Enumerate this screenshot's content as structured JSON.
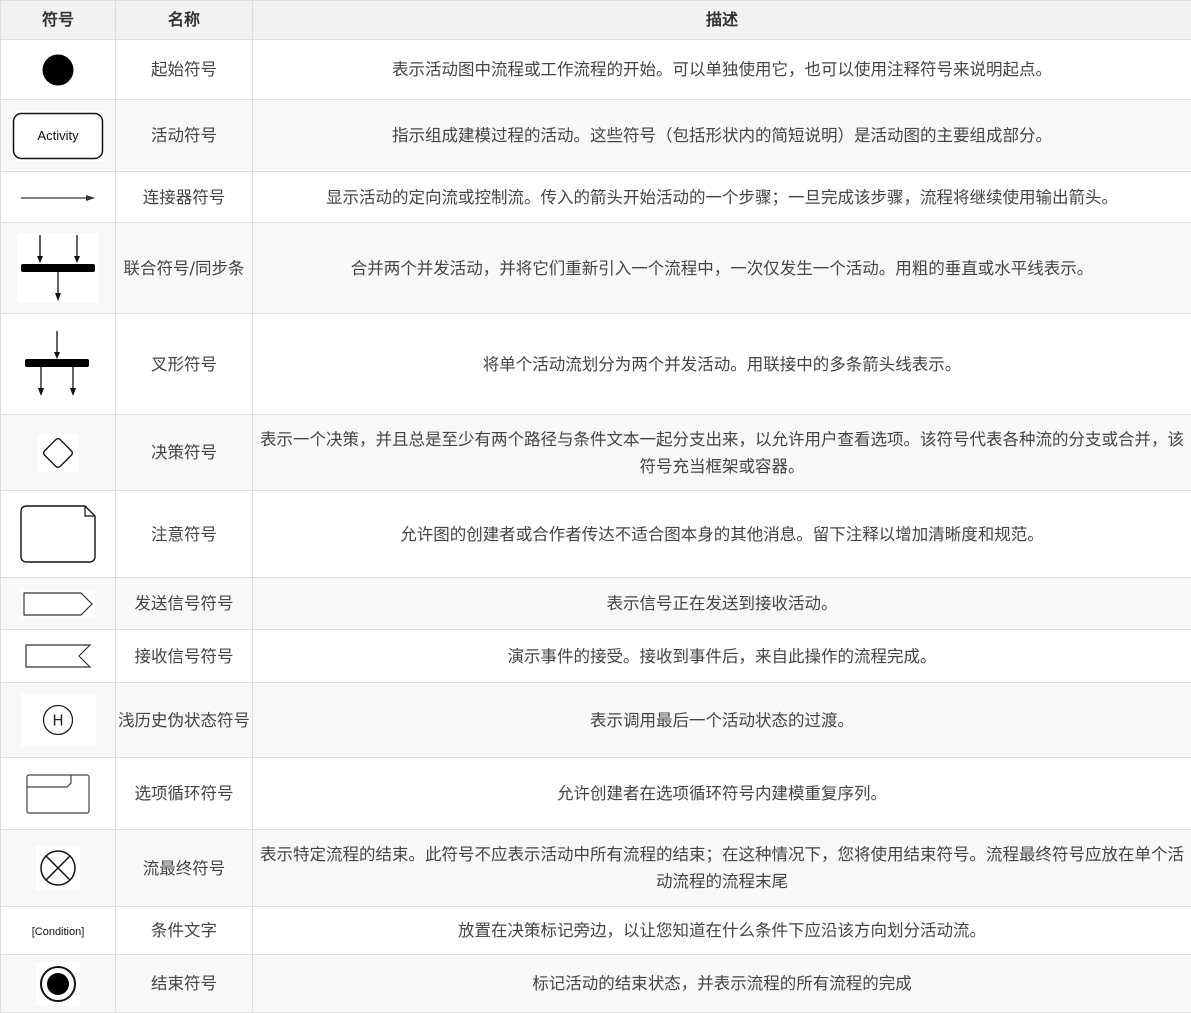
{
  "table": {
    "headers": {
      "symbol": "符号",
      "name": "名称",
      "description": "描述"
    },
    "rows": [
      {
        "icon": "initial-node-icon",
        "name": "起始符号",
        "description": "表示活动图中流程或工作流程的开始。可以单独使用它，也可以使用注释符号来说明起点。"
      },
      {
        "icon": "activity-icon",
        "icon_label": "Activity",
        "name": "活动符号",
        "description": "指示组成建模过程的活动。这些符号（包括形状内的简短说明）是活动图的主要组成部分。"
      },
      {
        "icon": "connector-arrow-icon",
        "name": "连接器符号",
        "description": "显示活动的定向流或控制流。传入的箭头开始活动的一个步骤；一旦完成该步骤，流程将继续使用输出箭头。"
      },
      {
        "icon": "join-bar-icon",
        "name": "联合符号/同步条",
        "description": "合并两个并发活动，并将它们重新引入一个流程中，一次仅发生一个活动。用粗的垂直或水平线表示。"
      },
      {
        "icon": "fork-bar-icon",
        "name": "叉形符号",
        "description": "将单个活动流划分为两个并发活动。用联接中的多条箭头线表示。"
      },
      {
        "icon": "decision-diamond-icon",
        "name": "决策符号",
        "description": "表示一个决策，并且总是至少有两个路径与条件文本一起分支出来，以允许用户查看选项。该符号代表各种流的分支或合并，该符号充当框架或容器。"
      },
      {
        "icon": "note-icon",
        "name": "注意符号",
        "description": "允许图的创建者或合作者传达不适合图本身的其他消息。留下注释以增加清晰度和规范。"
      },
      {
        "icon": "send-signal-icon",
        "name": "发送信号符号",
        "description": "表示信号正在发送到接收活动。"
      },
      {
        "icon": "receive-signal-icon",
        "name": "接收信号符号",
        "description": "演示事件的接受。接收到事件后，来自此操作的流程完成。"
      },
      {
        "icon": "shallow-history-icon",
        "icon_label": "H",
        "name": "浅历史伪状态符号",
        "description": "表示调用最后一个活动状态的过渡。"
      },
      {
        "icon": "option-loop-icon",
        "name": "选项循环符号",
        "description": "允许创建者在选项循环符号内建模重复序列。"
      },
      {
        "icon": "flow-final-icon",
        "name": "流最终符号",
        "description": "表示特定流程的结束。此符号不应表示活动中所有流程的结束；在这种情况下，您将使用结束符号。流程最终符号应放在单个活动流程的流程末尾"
      },
      {
        "icon": "condition-text-icon",
        "icon_label": "[Condition]",
        "name": "条件文字",
        "description": "放置在决策标记旁边，以让您知道在什么条件下应沿该方向划分活动流。"
      },
      {
        "icon": "final-node-icon",
        "name": "结束符号",
        "description": "标记活动的结束状态，并表示流程的所有流程的完成"
      }
    ]
  }
}
